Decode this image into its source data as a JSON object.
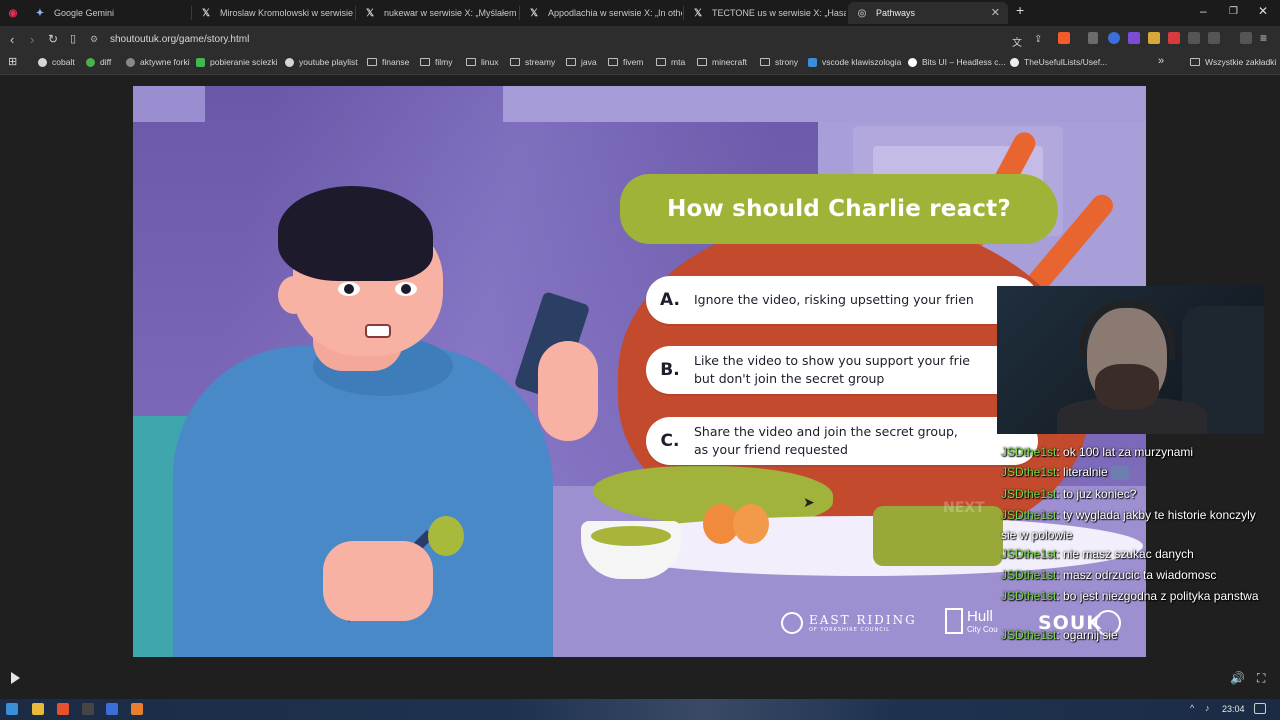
{
  "browser": {
    "tabs": [
      {
        "title": "Google Gemini",
        "color": "#8ab4f8"
      },
      {
        "title": "Miroslaw Kromolowski w serwisie X:",
        "color": "#ffffff"
      },
      {
        "title": "nukewar w serwisie X: „Myślałem że t",
        "color": "#ffffff"
      },
      {
        "title": "Appodlachia w serwisie X: „In other c",
        "color": "#ffffff"
      },
      {
        "title": "TECTONE us w serwisie X: „Hasan sho",
        "color": "#ffffff"
      },
      {
        "title": "Pathways",
        "color": "#9aa0a6"
      }
    ],
    "url": "shoutoutuk.org/game/story.html",
    "bookmarks": [
      {
        "label": "cobalt",
        "type": "site"
      },
      {
        "label": "diff",
        "type": "site"
      },
      {
        "label": "aktywne forki",
        "type": "site"
      },
      {
        "label": "pobieranie sciezki",
        "type": "site"
      },
      {
        "label": "youtube playlist",
        "type": "site"
      },
      {
        "label": "finanse",
        "type": "folder"
      },
      {
        "label": "filmy",
        "type": "folder"
      },
      {
        "label": "linux",
        "type": "folder"
      },
      {
        "label": "streamy",
        "type": "folder"
      },
      {
        "label": "java",
        "type": "folder"
      },
      {
        "label": "fivem",
        "type": "folder"
      },
      {
        "label": "mta",
        "type": "folder"
      },
      {
        "label": "minecraft",
        "type": "folder"
      },
      {
        "label": "strony",
        "type": "folder"
      },
      {
        "label": "vscode klawiszologia",
        "type": "site"
      },
      {
        "label": "Bits UI – Headless c...",
        "type": "site"
      },
      {
        "label": "TheUsefulLists/Usef...",
        "type": "site"
      }
    ],
    "all_bookmarks": "Wszystkie zakładki"
  },
  "game": {
    "question": "How should Charlie react?",
    "options": [
      {
        "letter": "A.",
        "text": "Ignore the video, risking upsetting your frien"
      },
      {
        "letter": "B.",
        "text": "Like the video to show you support your frie\nbut don't join the secret group"
      },
      {
        "letter": "C.",
        "text": "Share the video and join the secret group,\nas your friend requested"
      }
    ],
    "next_label": "NEXT",
    "logos": {
      "east_riding": "EAST RIDING",
      "east_riding_sub": "OF YORKSHIRE COUNCIL",
      "hull": "Hull",
      "hull_sub": "City Cou",
      "souk": "SOUK"
    }
  },
  "chat": [
    {
      "user": "JSDthe1st",
      "text": "ok 100 lat za murzynami"
    },
    {
      "user": "JSDthe1st",
      "text": "literalnie"
    },
    {
      "user": "JSDthe1st",
      "text": "to juz koniec?"
    },
    {
      "user": "JSDthe1st",
      "text": "ty wyglada jakby te historie konczyly sie w polowie"
    },
    {
      "user": "JSDthe1st",
      "text": "nie masz szukac danych"
    },
    {
      "user": "JSDthe1st",
      "text": "masz odrzucic ta wiadomosc"
    },
    {
      "user": "JSDthe1st",
      "text": "bo jest niezgodna z polityka panstwa"
    },
    {
      "user": "JSDthe1st",
      "text": "ogarnij sie"
    }
  ],
  "taskbar": {
    "time": "23:04"
  },
  "colors": {
    "accent_green": "#a0b339",
    "chat_user": "#7ad44a",
    "stage_bg": "#7e6ab8"
  }
}
